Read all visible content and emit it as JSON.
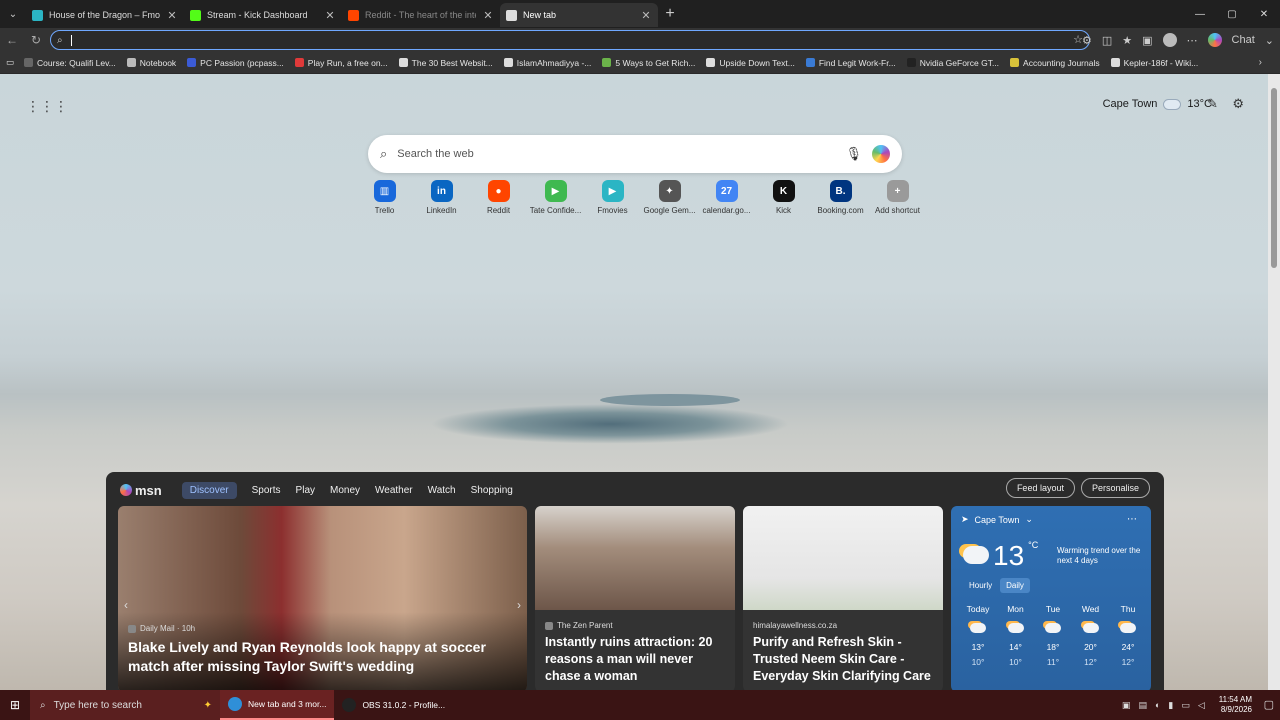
{
  "tabs": [
    {
      "label": "House of the Dragon – Fmovies",
      "color": "#2bb5c4",
      "state": "normal"
    },
    {
      "label": "Stream - Kick Dashboard",
      "color": "#53fc18",
      "state": "normal"
    },
    {
      "label": "Reddit - The heart of the internet",
      "color": "#ff4500",
      "state": "dim"
    },
    {
      "label": "New tab",
      "color": "#dddddd",
      "state": "active"
    }
  ],
  "window": {
    "minimize": "—",
    "maximize": "▢",
    "close": "✕"
  },
  "bookmarks": [
    {
      "label": "Course: Qualifi Lev...",
      "color": "#666"
    },
    {
      "label": "Notebook",
      "color": "#bbb"
    },
    {
      "label": "PC Passion (pcpass...",
      "color": "#3b5bd6"
    },
    {
      "label": "Play Run, a free on...",
      "color": "#e03a3a"
    },
    {
      "label": "The 30 Best Websit...",
      "color": "#ddd"
    },
    {
      "label": "IslamAhmadiyya -...",
      "color": "#ddd"
    },
    {
      "label": "5 Ways to Get Rich...",
      "color": "#6bb34a"
    },
    {
      "label": "Upside Down Text...",
      "color": "#ddd"
    },
    {
      "label": "Find Legit Work-Fr...",
      "color": "#3a7bd5"
    },
    {
      "label": "Nvidia GeForce GT...",
      "color": "#222"
    },
    {
      "label": "Accounting Journals",
      "color": "#d8c23a"
    },
    {
      "label": "Kepler-186f - Wiki...",
      "color": "#ddd"
    }
  ],
  "chat_label": "Chat",
  "ntp": {
    "location": "Cape Town",
    "temp": "13",
    "temp_unit": "°C",
    "search_placeholder": "Search the web"
  },
  "shortcuts": [
    {
      "label": "Trello",
      "letter": "▥",
      "color": "#1868db"
    },
    {
      "label": "LinkedIn",
      "letter": "in",
      "color": "#0a66c2"
    },
    {
      "label": "Reddit",
      "letter": "●",
      "color": "#ff4500"
    },
    {
      "label": "Tate Confide...",
      "letter": "▶",
      "color": "#3fb950"
    },
    {
      "label": "Fmovies",
      "letter": "▶",
      "color": "#2bb5c4"
    },
    {
      "label": "Google Gem...",
      "letter": "✦",
      "color": "#555555"
    },
    {
      "label": "calendar.go...",
      "letter": "27",
      "color": "#4285f4"
    },
    {
      "label": "Kick",
      "letter": "K",
      "color": "#111111"
    },
    {
      "label": "Booking.com",
      "letter": "B.",
      "color": "#003580"
    },
    {
      "label": "Add shortcut",
      "letter": "+",
      "color": "#9a9a9a"
    }
  ],
  "feed": {
    "logo": "msn",
    "tabs": [
      "Discover",
      "Sports",
      "Play",
      "Money",
      "Weather",
      "Watch",
      "Shopping"
    ],
    "feed_layout": "Feed layout",
    "personalise": "Personalise",
    "cards": [
      {
        "source": "Daily Mail · 10h",
        "headline": "Blake Lively and Ryan Reynolds look happy at soccer match after missing Taylor Swift's wedding"
      },
      {
        "source": "The Zen Parent",
        "headline": "Instantly ruins attraction: 20 reasons a man will never chase a woman"
      },
      {
        "source": "himalayawellness.co.za",
        "headline": "Purify and Refresh Skin - Trusted Neem Skin Care - Everyday Skin Clarifying Care"
      }
    ],
    "weather": {
      "city": "Cape Town",
      "temp": "13",
      "unit": "°C",
      "trend": "Warming trend over the next 4 days",
      "hourly": "Hourly",
      "daily": "Daily",
      "days": [
        {
          "day": "Today",
          "hi": "13°",
          "lo": "10°"
        },
        {
          "day": "Mon",
          "hi": "14°",
          "lo": "10°"
        },
        {
          "day": "Tue",
          "hi": "18°",
          "lo": "11°"
        },
        {
          "day": "Wed",
          "hi": "20°",
          "lo": "12°"
        },
        {
          "day": "Thu",
          "hi": "24°",
          "lo": "12°"
        }
      ]
    }
  },
  "taskbar": {
    "search": "Type here to search",
    "apps": [
      {
        "label": "New tab and 3 mor...",
        "color": "#2f8fd8",
        "active": true
      },
      {
        "label": "OBS 31.0.2 - Profile...",
        "color": "#222222",
        "active": false
      }
    ],
    "time": "11:54 AM",
    "date": "8/9/2026"
  }
}
